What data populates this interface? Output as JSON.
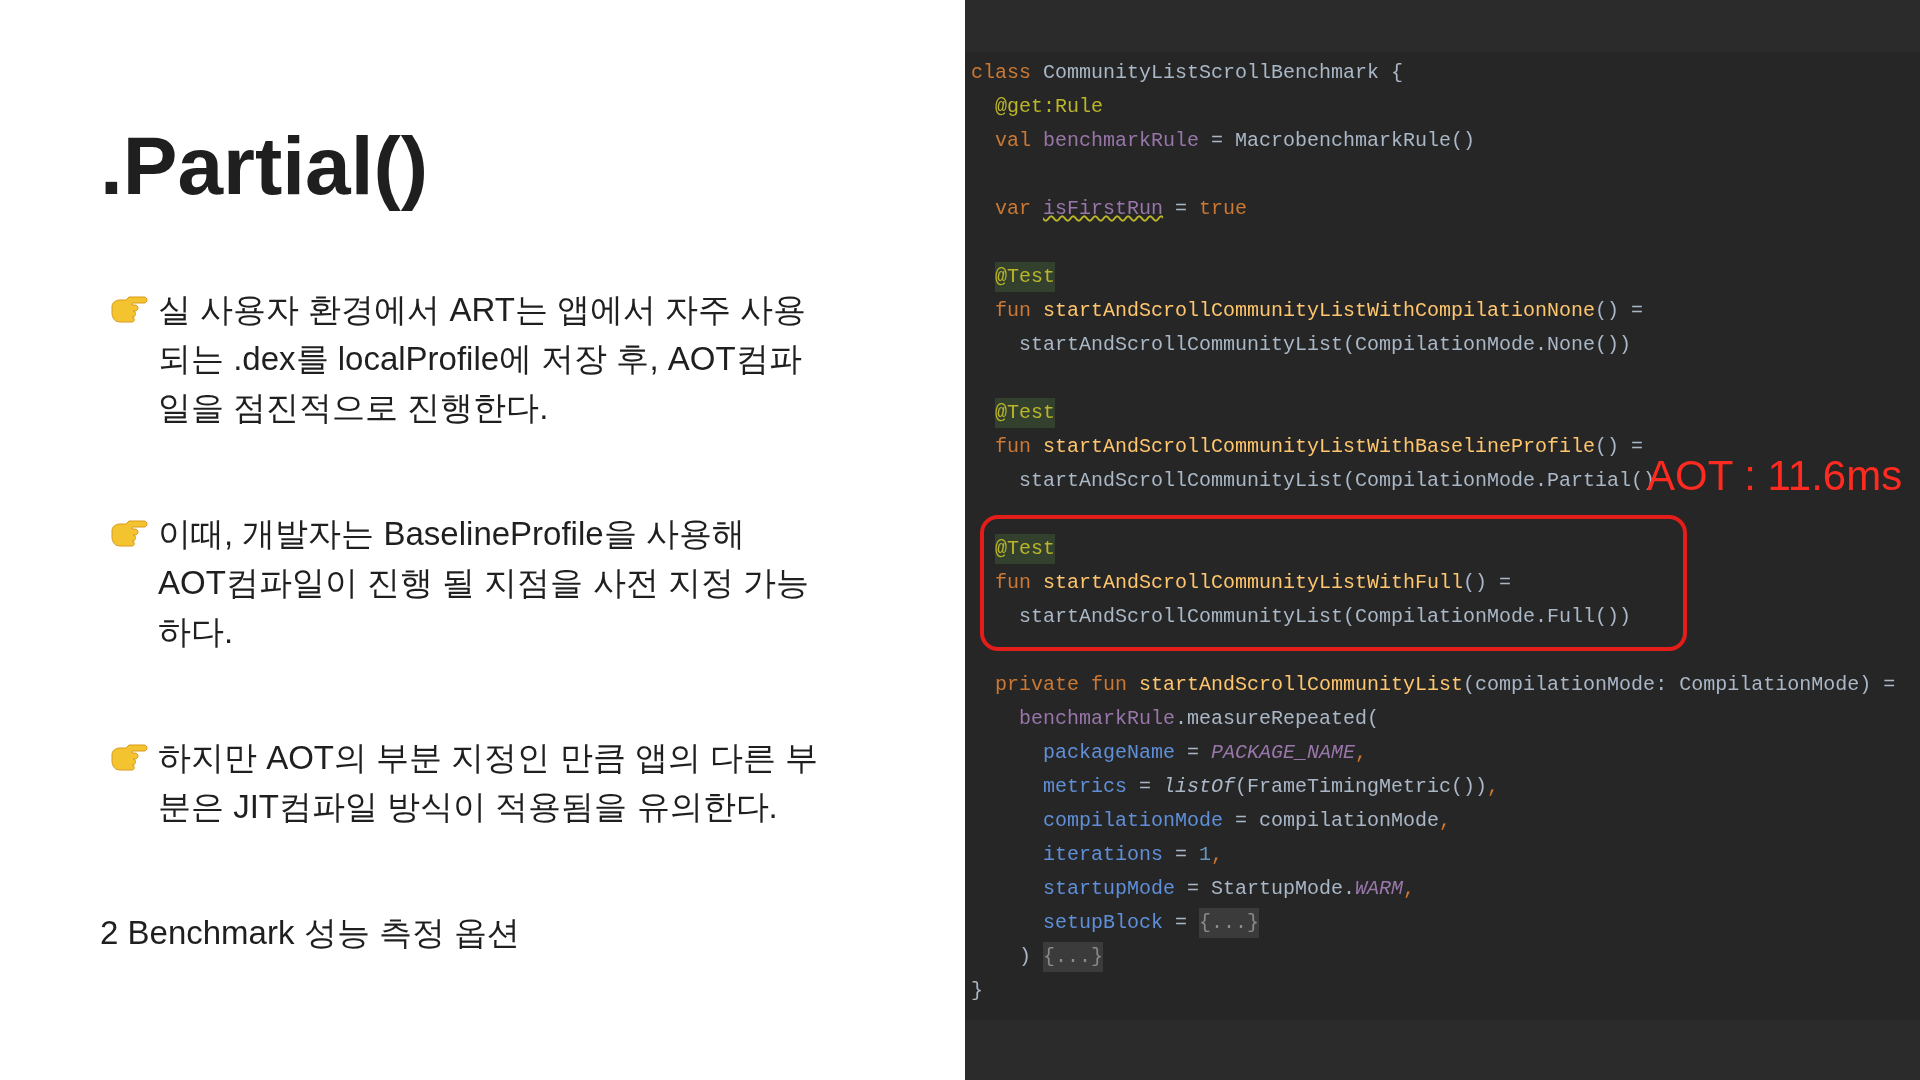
{
  "slide": {
    "title": ".Partial()",
    "bullets": [
      {
        "kind": "pointer",
        "text": "실 사용자 환경에서 ART는 앱에서 자주 사용되는 .dex를 localProfile에 저장 후, AOT컴파일을 점진적으로 진행한다."
      },
      {
        "kind": "pointer",
        "text": "이때, 개발자는 BaselineProfile을 사용해 AOT컴파일이 진행 될 지점을 사전 지정 가능하다."
      },
      {
        "kind": "pointer",
        "text": "하지만 AOT의 부분 지정인 만큼 앱의 다른 부분은 JIT컴파일 방식이 적용됨을 유의한다."
      },
      {
        "kind": "plain",
        "text": "2 Benchmark 성능 측정 옵션"
      }
    ]
  },
  "code": {
    "callout": "AOT : 11.6ms",
    "blocks": [
      {
        "boxed": false,
        "lines": [
          {
            "kind": "code",
            "tokens": [
              {
                "kind": "keyword",
                "t": "class "
              },
              {
                "kind": "plain",
                "t": "CommunityListScrollBenchmark {"
              }
            ]
          },
          {
            "kind": "code",
            "tokens": [
              {
                "kind": "annotation",
                "t": "  @get:Rule"
              }
            ]
          },
          {
            "kind": "code",
            "tokens": [
              {
                "kind": "keyword",
                "t": "  val "
              },
              {
                "kind": "prop",
                "t": "benchmarkRule"
              },
              {
                "kind": "plain",
                "t": " = MacrobenchmarkRule()"
              }
            ]
          },
          {
            "kind": "blank"
          },
          {
            "kind": "code",
            "tokens": [
              {
                "kind": "keyword",
                "t": "  var "
              },
              {
                "kind": "warning",
                "t": "isFirstRun"
              },
              {
                "kind": "plain",
                "t": " = "
              },
              {
                "kind": "keyword",
                "t": "true"
              }
            ]
          },
          {
            "kind": "blank"
          },
          {
            "kind": "code",
            "tokens": [
              {
                "kind": "marked",
                "t": "@Test"
              }
            ]
          },
          {
            "kind": "code",
            "tokens": [
              {
                "kind": "keyword",
                "t": "  fun "
              },
              {
                "kind": "fn",
                "t": "startAndScrollCommunityListWithCompilationNone"
              },
              {
                "kind": "plain",
                "t": "() ="
              }
            ]
          },
          {
            "kind": "code",
            "tokens": [
              {
                "kind": "plain",
                "t": "    startAndScrollCommunityList(CompilationMode.None())"
              }
            ]
          },
          {
            "kind": "blank"
          },
          {
            "kind": "code",
            "tokens": [
              {
                "kind": "marked",
                "t": "@Test"
              }
            ]
          },
          {
            "kind": "code",
            "tokens": [
              {
                "kind": "keyword",
                "t": "  fun "
              },
              {
                "kind": "fn",
                "t": "startAndScrollCommunityListWithBaselineProfile"
              },
              {
                "kind": "plain",
                "t": "() ="
              }
            ]
          },
          {
            "kind": "code",
            "tokens": [
              {
                "kind": "plain",
                "t": "    startAndScrollCommunityList(CompilationMode.Partial()"
              }
            ]
          },
          {
            "kind": "blank"
          }
        ]
      },
      {
        "boxed": true,
        "lines": [
          {
            "kind": "code",
            "tokens": [
              {
                "kind": "marked",
                "t": "@Test"
              }
            ]
          },
          {
            "kind": "code",
            "tokens": [
              {
                "kind": "keyword",
                "t": "  fun "
              },
              {
                "kind": "fn",
                "t": "startAndScrollCommunityListWithFull"
              },
              {
                "kind": "plain",
                "t": "() ="
              }
            ]
          },
          {
            "kind": "code",
            "tokens": [
              {
                "kind": "plain",
                "t": "    startAndScrollCommunityList(CompilationMode.Full())"
              }
            ]
          }
        ]
      },
      {
        "boxed": false,
        "lines": [
          {
            "kind": "blank"
          },
          {
            "kind": "code",
            "tokens": [
              {
                "kind": "keyword",
                "t": "  private fun "
              },
              {
                "kind": "fn",
                "t": "startAndScrollCommunityList"
              },
              {
                "kind": "plain",
                "t": "(compilationMode: CompilationMode) ="
              }
            ]
          },
          {
            "kind": "code",
            "tokens": [
              {
                "kind": "prop",
                "t": "    benchmarkRule"
              },
              {
                "kind": "plain",
                "t": ".measureRepeated("
              }
            ]
          },
          {
            "kind": "code",
            "tokens": [
              {
                "kind": "param",
                "t": "      packageName"
              },
              {
                "kind": "plain",
                "t": " = "
              },
              {
                "kind": "const",
                "t": "PACKAGE_NAME"
              },
              {
                "kind": "keyword",
                "t": ","
              }
            ]
          },
          {
            "kind": "code",
            "tokens": [
              {
                "kind": "param",
                "t": "      metrics"
              },
              {
                "kind": "plain",
                "t": " = "
              },
              {
                "kind": "call",
                "t": "listOf"
              },
              {
                "kind": "plain",
                "t": "(FrameTimingMetric())"
              },
              {
                "kind": "keyword",
                "t": ","
              }
            ]
          },
          {
            "kind": "code",
            "tokens": [
              {
                "kind": "param",
                "t": "      compilationMode"
              },
              {
                "kind": "plain",
                "t": " = compilationMode"
              },
              {
                "kind": "keyword",
                "t": ","
              }
            ]
          },
          {
            "kind": "code",
            "tokens": [
              {
                "kind": "param",
                "t": "      iterations"
              },
              {
                "kind": "plain",
                "t": " = "
              },
              {
                "kind": "number",
                "t": "1"
              },
              {
                "kind": "keyword",
                "t": ","
              }
            ]
          },
          {
            "kind": "code",
            "tokens": [
              {
                "kind": "param",
                "t": "      startupMode"
              },
              {
                "kind": "plain",
                "t": " = StartupMode."
              },
              {
                "kind": "const",
                "t": "WARM"
              },
              {
                "kind": "keyword",
                "t": ","
              }
            ]
          },
          {
            "kind": "code",
            "tokens": [
              {
                "kind": "param",
                "t": "      setupBlock"
              },
              {
                "kind": "plain",
                "t": " = "
              },
              {
                "kind": "fold",
                "t": "{...}"
              }
            ]
          },
          {
            "kind": "code",
            "tokens": [
              {
                "kind": "plain",
                "t": "    ) "
              },
              {
                "kind": "fold",
                "t": "{...}"
              }
            ]
          },
          {
            "kind": "code",
            "tokens": [
              {
                "kind": "plain",
                "t": "}"
              }
            ]
          }
        ]
      }
    ]
  }
}
